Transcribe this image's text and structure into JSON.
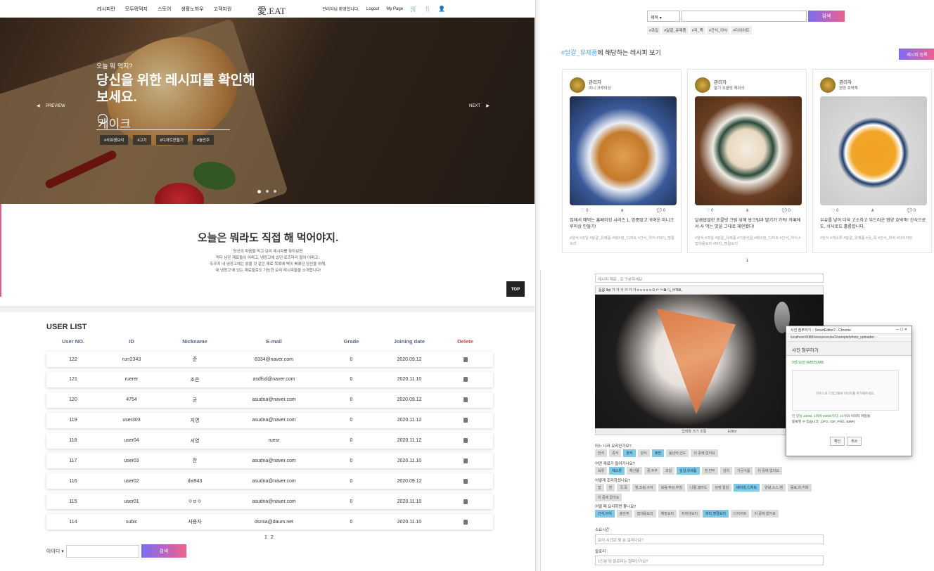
{
  "site": {
    "nav": [
      "레시피란",
      "모두뭐먹지",
      "스토어",
      "생활노하우",
      "고객지원"
    ],
    "logo": "愛.EAT",
    "welcome": "관리자님 환영합니다.",
    "logout": "Logout",
    "mypage": "My Page"
  },
  "hero": {
    "question": "오늘 뭐 먹지?",
    "headline": "당신을 위한 레시피를 확인해보세요.",
    "search_value": "케이크",
    "tags": [
      "#사워생요리",
      "#고기",
      "#디저트만들기",
      "#술안주"
    ],
    "prev": "PREVIEW",
    "next": "NEXT"
  },
  "intro": {
    "title": "오늘은 뭐라도 직접 해 먹어야지.",
    "lines": [
      "당신의 마음을 먹고 요리 레시피를 찾아보면",
      "적다 남은 재료들이 어쩌고, 냉장고에 있던 로즈마리 떨어 어쩌고..",
      "도우지 내 냉장고에는 없을 것 같은 재료 목록에 벽이 빠졌던 당신을 위해,",
      "'내 냉장고'에 있는 재료들로도 가능한 요리 레시피들을 소개합니다!"
    ],
    "top": "TOP"
  },
  "userlist": {
    "title": "USER LIST",
    "headers": [
      "User NO.",
      "ID",
      "Nickname",
      "E-mail",
      "Grade",
      "Joining date",
      "Delete"
    ],
    "rows": [
      [
        "122",
        "rurr2343",
        "준",
        "8334@naver.com",
        "0",
        "2020.09.12"
      ],
      [
        "121",
        "ruerer",
        "조은",
        "asdfsd@naver.com",
        "0",
        "2020.11.10"
      ],
      [
        "120",
        "4754",
        "균",
        "asudna@naver.com",
        "0",
        "2020.09.12"
      ],
      [
        "119",
        "user303",
        "지영",
        "asudna@naver.com",
        "0",
        "2020.11.12"
      ],
      [
        "118",
        "user04",
        "서영",
        "ruesr",
        "0",
        "2020.11.12"
      ],
      [
        "117",
        "user03",
        "잔",
        "asudna@naver.com",
        "0",
        "2020.11.10"
      ],
      [
        "116",
        "user02",
        "dw943",
        "asudna@naver.com",
        "0",
        "2020.09.12"
      ],
      [
        "115",
        "user01",
        "ㅇㅁㅇ",
        "asudna@naver.com",
        "0",
        "2020.11.10"
      ],
      [
        "114",
        "subic",
        "사용자",
        "dsnsa@daum.net",
        "0",
        "2020.11.10"
      ]
    ],
    "pages": [
      "1",
      "2"
    ],
    "search_select": "아이디",
    "search_btn": "검색"
  },
  "recipes": {
    "select": "제목",
    "search_btn": "검색",
    "tags": [
      "#과일",
      "#달걀_유제품",
      "#국_죽",
      "#간식_야식",
      "#다이어트"
    ],
    "title_hl": "#달걀_유제품",
    "title_rest": "에 해당하는 레시피 보기",
    "add_btn": "레시피 등록",
    "cards": [
      {
        "author": "관리자",
        "name": "미니 크루아상",
        "likes": "0",
        "comments": "0",
        "desc": "집에서 해먹는 홈베이킹 시리즈 1, 앙증맞고 귀여운 미니크루아상 만들기!",
        "tags": "#양식 #과일 #달걀_유제품 #베이킹_디저트 #간식_야식 #파티_명절요리"
      },
      {
        "author": "관리자",
        "name": "딸기 초콜릿 케이크",
        "likes": "0",
        "comments": "0",
        "desc": "달콤쌉쌀한 초콜릿 크림 위에 생크림과 딸기가 가득! 카페에서 사 먹는 맛을 그대로 재현했다!",
        "tags": "#양식 #과일 #달걀_유제품 #기분식음 #베이킹_디저트 #간식_야식 #접대용요리 #파티_명절요리"
      },
      {
        "author": "관리자",
        "name": "영양 호박죽",
        "likes": "0",
        "comments": "0",
        "desc": "우유를 넣어 더욱 고소하고 부드러운 영양 호박죽! 간식으로도, 식사로도 훌륭합니다.",
        "tags": "#한식 #채소류 #달걀_유제품 #국_죽 #간식_야식 #다이어트"
      }
    ],
    "page": "1"
  },
  "editor": {
    "name_placeholder": "레시피 재료 , 로 구분하세요",
    "toolbar": "돋움  9pt  가 가 가 가  가  가 ≡ ≡ ≡ ≡ ≡ Ω ↶ ↷ ⧉ 🔍  HTML",
    "scroll_label": "입력창 크기 조절",
    "editor_tab": "Editor",
    "q1": "어느 나라 요리인가요?",
    "q1_opts": [
      {
        "t": "한식",
        "on": false
      },
      {
        "t": "중식",
        "on": false
      },
      {
        "t": "양식",
        "on": true
      },
      {
        "t": "일식",
        "on": false
      },
      {
        "t": "퓨전",
        "on": true
      },
      {
        "t": "동남아,인도",
        "on": false
      },
      {
        "t": "이 중에 없어요",
        "on": false
      }
    ],
    "q2": "어떤 재료가 들어가나요?",
    "q2_opts": [
      {
        "t": "육류",
        "on": false
      },
      {
        "t": "채소류",
        "on": true
      },
      {
        "t": "해산물",
        "on": false
      },
      {
        "t": "콩,두부",
        "on": false
      },
      {
        "t": "과일",
        "on": false
      },
      {
        "t": "달걀,유제품",
        "on": true
      },
      {
        "t": "면,만두",
        "on": false
      },
      {
        "t": "김치",
        "on": false
      },
      {
        "t": "가공식품",
        "on": false
      },
      {
        "t": "이 중에 없어요",
        "on": false
      }
    ],
    "q3": "어떻게 조리하셨나요?",
    "q3_opts": [
      {
        "t": "밥",
        "on": false
      },
      {
        "t": "면",
        "on": false
      },
      {
        "t": "국,죽",
        "on": false
      },
      {
        "t": "찜,조림,구이",
        "on": false
      },
      {
        "t": "볶음,튀김,부침",
        "on": false
      },
      {
        "t": "나물,샐러드",
        "on": false
      },
      {
        "t": "김장,절임",
        "on": false
      },
      {
        "t": "베이킹,디저트",
        "on": true
      },
      {
        "t": "양념,소스,잼",
        "on": false
      },
      {
        "t": "음료,차,커피",
        "on": false
      },
      {
        "t": "이 중에 없어요",
        "on": false
      }
    ],
    "q4": "어떨 때 요리하면 좋나요?",
    "q4_opts": [
      {
        "t": "간식,야식",
        "on": true
      },
      {
        "t": "술안주",
        "on": false
      },
      {
        "t": "접대용요리",
        "on": false
      },
      {
        "t": "해장요리",
        "on": false
      },
      {
        "t": "자취생요리",
        "on": false
      },
      {
        "t": "파티,명절요리",
        "on": true
      },
      {
        "t": "다이어트",
        "on": false
      },
      {
        "t": "이 중에 없어요",
        "on": false
      }
    ],
    "time_label": "소요시간 :",
    "time_ph": "요리 시간은 몇 분 걸리나요?",
    "cal_label": "칼로리 :",
    "cal_ph": "1인분 당 칼로리는 얼마인가요?"
  },
  "popup": {
    "title": "사진 첨부하기 :: SmartEditor2 - Chrome",
    "url": "localhost:8088/resources/se2/sample/photo_uploader...",
    "header": "사진 첨부하기",
    "count": "0장/10장   0MB/50MB",
    "drop": "마우스로 드래그해서 이미지를 추가해주세요.",
    "note1": "한 장당 10MB, 1회에 50MB까지, 10개",
    "note2": "의 이미지 파일을",
    "note3": "등록할 수 있습니다. (JPG, GIF, PNG, BMP)",
    "ok": "확인",
    "cancel": "취소"
  }
}
